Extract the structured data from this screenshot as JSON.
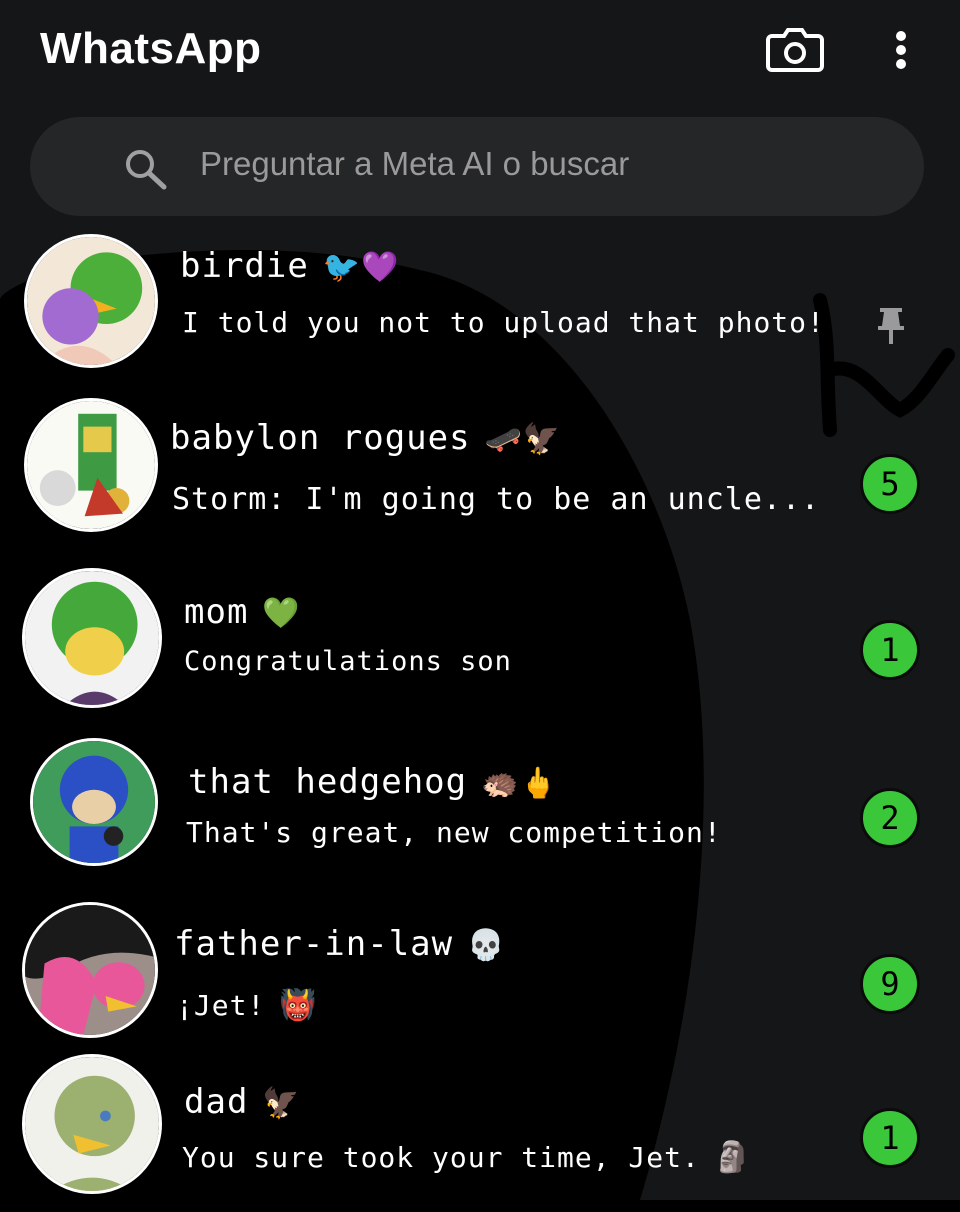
{
  "header": {
    "title": "WhatsApp",
    "camera_icon": "camera-icon",
    "menu_icon": "more-vertical-icon"
  },
  "search": {
    "placeholder": "Preguntar a Meta AI o buscar",
    "icon": "search-icon"
  },
  "chats": [
    {
      "name": "birdie",
      "emoji": "🐦💜",
      "message": "I told you not to upload that photo!",
      "pinned": true,
      "unread": null
    },
    {
      "name": "babylon rogues",
      "emoji": "🛹🦅",
      "message": "Storm: I'm going to be an uncle...",
      "pinned": false,
      "unread": "5"
    },
    {
      "name": "mom",
      "emoji": "💚",
      "message": "Congratulations son",
      "pinned": false,
      "unread": "1"
    },
    {
      "name": "that hedgehog",
      "emoji": "🦔🖕",
      "message": "That's great, new competition!",
      "pinned": false,
      "unread": "2"
    },
    {
      "name": "father-in-law",
      "emoji": "💀",
      "message": "¡Jet!",
      "message_emoji": "👹",
      "pinned": false,
      "unread": "9"
    },
    {
      "name": "dad",
      "emoji": "🦅",
      "message": "You sure took your time, Jet.",
      "message_emoji": "🗿",
      "pinned": false,
      "unread": "1"
    }
  ],
  "colors": {
    "background": "#000000",
    "search_bg": "#242628",
    "badge": "#3ac83a",
    "placeholder": "#9a9a9a"
  }
}
